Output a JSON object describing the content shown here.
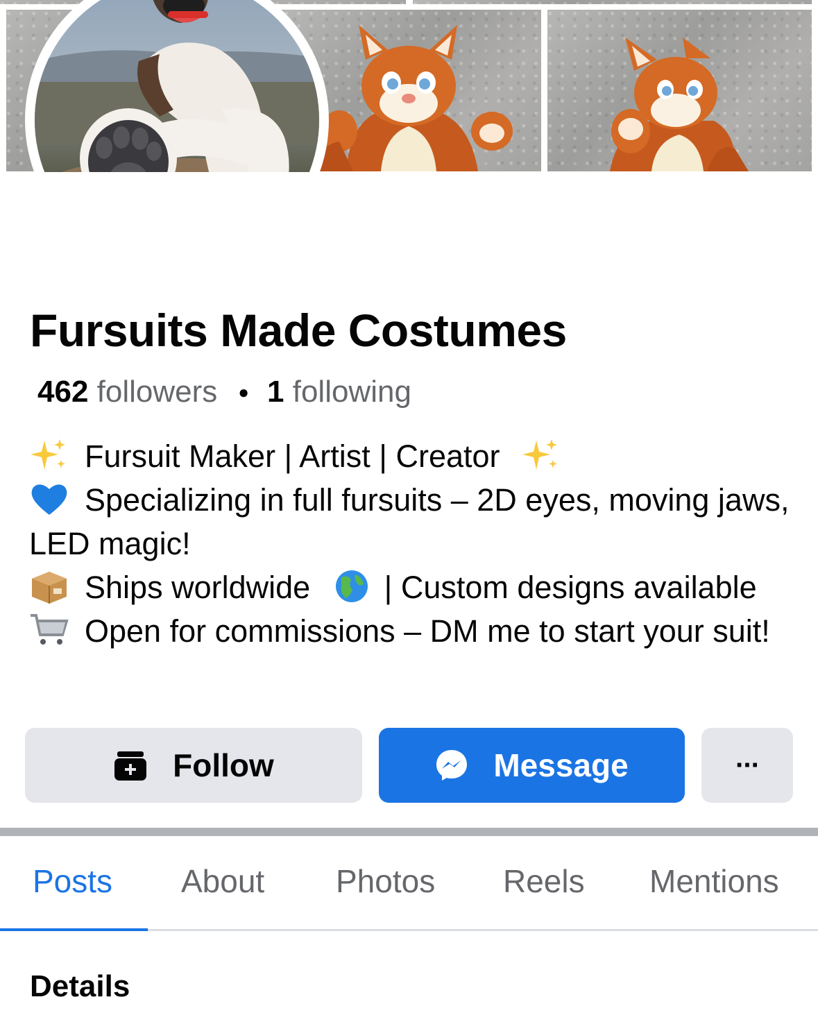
{
  "profile": {
    "name": "Fursuits Made Costumes",
    "followers_count": "462",
    "followers_label": "followers",
    "following_count": "1",
    "following_label": "following",
    "bio": [
      {
        "icon": "sparkles-emoji",
        "text": "Fursuit Maker | Artist | Creator",
        "trail_icon": "sparkles-emoji"
      },
      {
        "icon": "blue-heart-emoji",
        "text": "Specializing in full fursuits – 2D eyes, moving jaws, LED magic!"
      },
      {
        "icon": "package-emoji",
        "text": "Ships worldwide",
        "mid_icon": "globe-emoji",
        "text2": "| Custom designs available"
      },
      {
        "icon": "shopping-cart-emoji",
        "text": "Open for commissions – DM me to start your suit!"
      }
    ]
  },
  "actions": {
    "follow_label": "Follow",
    "message_label": "Message",
    "more_label": "···"
  },
  "tabs": [
    {
      "label": "Posts",
      "active": true
    },
    {
      "label": "About",
      "active": false
    },
    {
      "label": "Photos",
      "active": false
    },
    {
      "label": "Reels",
      "active": false
    },
    {
      "label": "Mentions",
      "active": false
    }
  ],
  "section": {
    "title": "Details"
  },
  "colors": {
    "accent": "#1b74e4",
    "button_gray": "#e4e6eb",
    "secondary_text": "#65676b"
  }
}
